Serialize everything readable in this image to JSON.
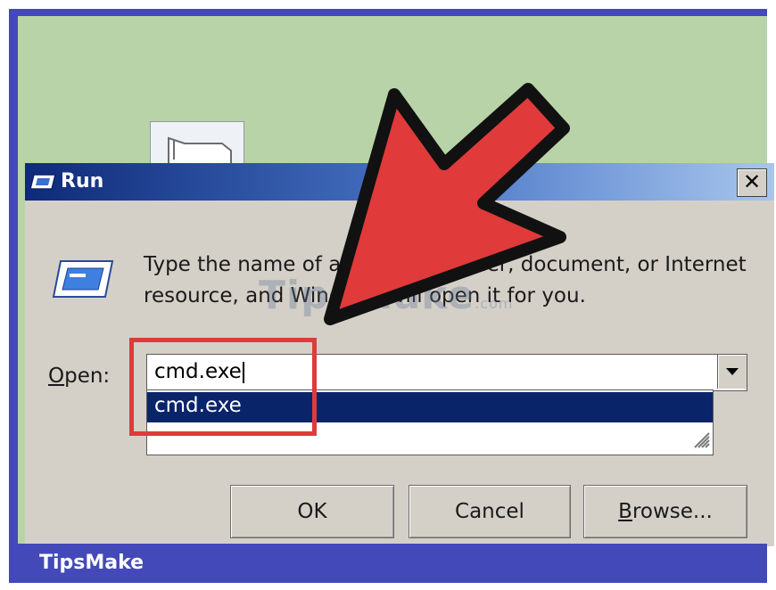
{
  "dialog": {
    "title": "Run",
    "close_glyph": "✕",
    "description": "Type the name of a program, folder, document, or Internet resource, and Windows will open it for you.",
    "open_label_accel": "O",
    "open_label_rest": "pen:",
    "open_value": "cmd.exe",
    "dropdown_items": [
      "cmd.exe"
    ],
    "buttons": {
      "ok": "OK",
      "cancel": "Cancel",
      "browse_accel": "B",
      "browse_rest": "rowse..."
    }
  },
  "watermark": {
    "text": "TipsMake",
    "suffix": ".com"
  },
  "brand": "TipsMake",
  "icons": [
    "run-program-icon",
    "close-icon",
    "chevron-down-icon",
    "resize-grip-icon",
    "desktop-shortcut-icon",
    "pointer-arrow-icon"
  ],
  "colors": {
    "frame": "#4349b8",
    "titlebar_start": "#0e2a78",
    "selection": "#0a246a",
    "highlight": "#e03a3a",
    "arrow": "#e03a3a"
  }
}
